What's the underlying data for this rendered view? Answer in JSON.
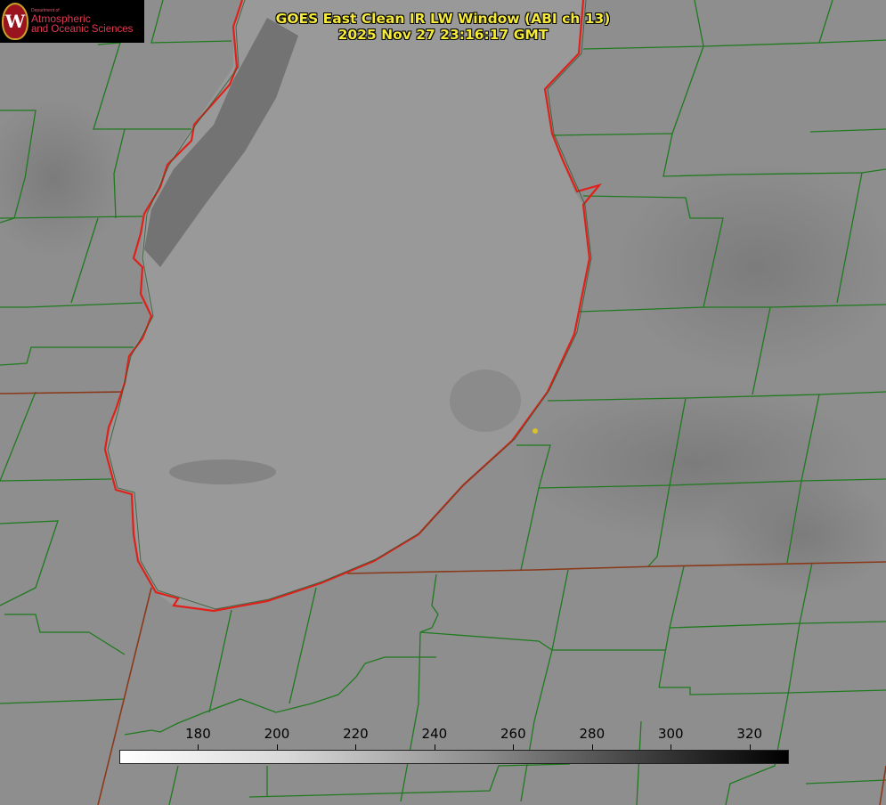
{
  "header": {
    "title_line1": "GOES East Clean IR LW Window (ABI ch 13)",
    "title_line2": "2025 Nov 27 23:16:17 GMT"
  },
  "logo": {
    "dept": "Department of",
    "line1": "Atmospheric",
    "line2": "and Oceanic Sciences",
    "seal_letter": "W"
  },
  "colorbar": {
    "unit_min": 160,
    "unit_max": 330,
    "ticks": [
      "180",
      "200",
      "220",
      "240",
      "260",
      "280",
      "300",
      "320"
    ],
    "tick_values": [
      180,
      200,
      220,
      240,
      260,
      280,
      300,
      320
    ]
  },
  "colors": {
    "county_lines": "#1f7a1f",
    "shoreline": "#e0201a",
    "state_lines": "#8a3a1a",
    "title_text": "#f5ea3a",
    "site_marker": "#d7c22a"
  }
}
